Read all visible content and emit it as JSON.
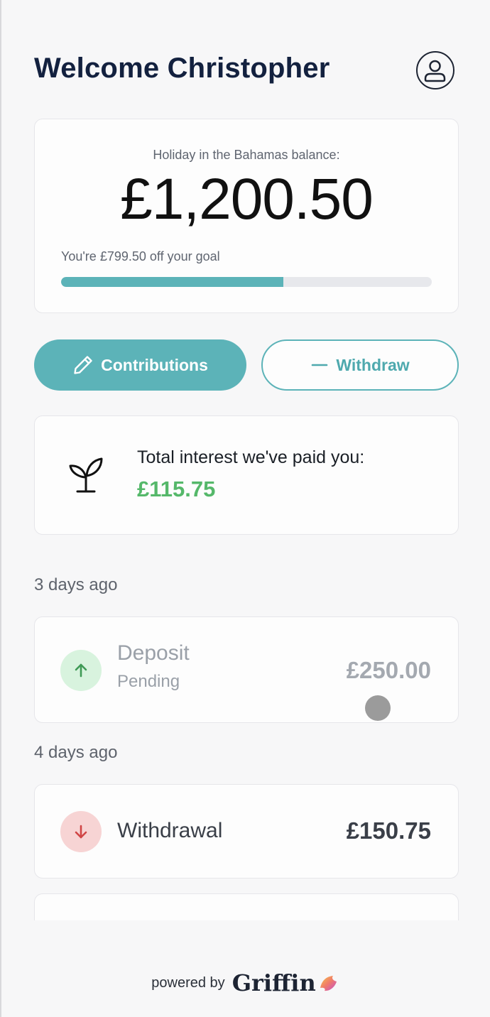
{
  "header": {
    "title": "Welcome Christopher",
    "avatar_icon": "user-icon"
  },
  "balance": {
    "label": "Holiday in the Bahamas balance:",
    "amount": "£1,200.50",
    "goal_text": "You're £799.50 off your goal",
    "progress": 0.6
  },
  "actions": {
    "contributions_label": "Contributions",
    "contributions_icon": "pencil-icon",
    "withdraw_label": "Withdraw",
    "withdraw_icon": "minus-icon"
  },
  "interest": {
    "icon": "sprout-icon",
    "label": "Total interest we've paid you:",
    "value": "£115.75"
  },
  "transactions": [
    {
      "group": "3 days ago",
      "title": "Deposit",
      "status": "Pending",
      "amount": "£250.00",
      "direction": "up",
      "icon": "arrow-up-icon"
    },
    {
      "group": "4 days ago",
      "title": "Withdrawal",
      "status": "",
      "amount": "£150.75",
      "direction": "down",
      "icon": "arrow-down-icon"
    }
  ],
  "footer": {
    "powered_by": "powered by",
    "brand": "Griffin"
  },
  "colors": {
    "accent": "#5cb3b8",
    "interest_green": "#55b86a",
    "deposit_bg": "#d8f3de",
    "deposit_arrow": "#3f9a55",
    "withdraw_bg": "#f7d4d4",
    "withdraw_arrow": "#d04545"
  }
}
